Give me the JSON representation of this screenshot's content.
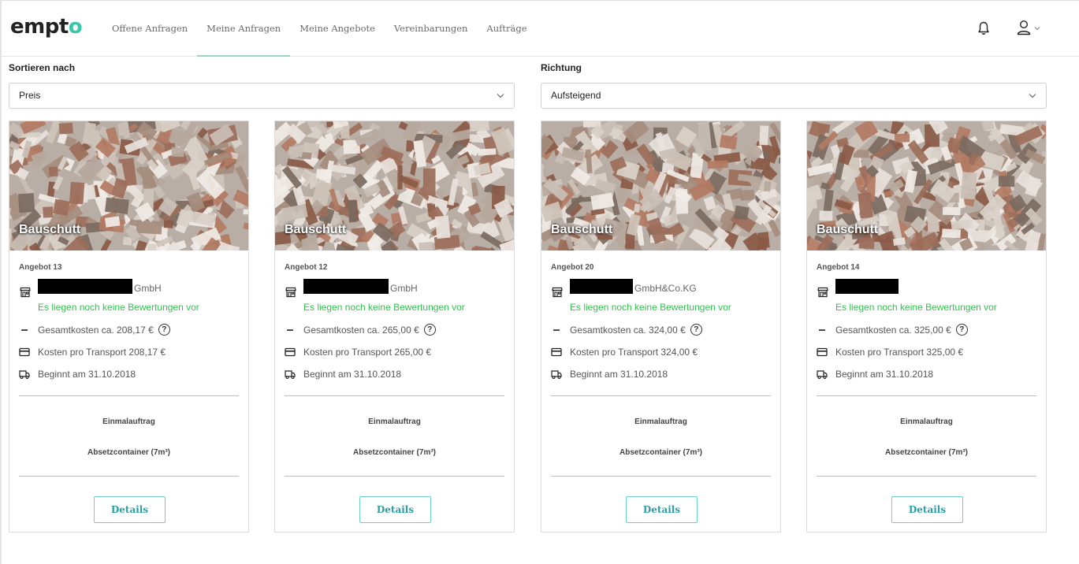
{
  "app": {
    "logo_main": "empt",
    "logo_accent": "o",
    "brand_color": "#3cc6a8"
  },
  "nav": {
    "items": [
      "Offene Anfragen",
      "Meine Anfragen",
      "Meine Angebote",
      "Vereinbarungen",
      "Aufträge"
    ],
    "active_index": 1
  },
  "header_icons": [
    "bell-icon",
    "user-icon",
    "chevron-down-icon"
  ],
  "sort": {
    "label": "Sortieren nach",
    "value": "Preis"
  },
  "direction": {
    "label": "Richtung",
    "value": "Aufsteigend"
  },
  "cards": [
    {
      "category": "Bauschutt",
      "offer": "Angebot 13",
      "company_suffix": "GmbH",
      "ratings": "Es liegen noch keine Bewertungen vor",
      "total": "Gesamtkosten ca. 208,17 €",
      "per_transport": "Kosten pro Transport 208,17 €",
      "start": "Beginnt am 31.10.2018",
      "order_type": "Einmalauftrag",
      "container": "Absetzcontainer (7m³)",
      "details": "Details"
    },
    {
      "category": "Bauschutt",
      "offer": "Angebot 12",
      "company_suffix": "GmbH",
      "ratings": "Es liegen noch keine Bewertungen vor",
      "total": "Gesamtkosten ca. 265,00 €",
      "per_transport": "Kosten pro Transport 265,00 €",
      "start": "Beginnt am 31.10.2018",
      "order_type": "Einmalauftrag",
      "container": "Absetzcontainer (7m³)",
      "details": "Details"
    },
    {
      "category": "Bauschutt",
      "offer": "Angebot 20",
      "company_suffix": "GmbH&Co.KG",
      "ratings": "Es liegen noch keine Bewertungen vor",
      "total": "Gesamtkosten ca. 324,00 €",
      "per_transport": "Kosten pro Transport 324,00 €",
      "start": "Beginnt am 31.10.2018",
      "order_type": "Einmalauftrag",
      "container": "Absetzcontainer (7m³)",
      "details": "Details"
    },
    {
      "category": "Bauschutt",
      "offer": "Angebot 14",
      "company_suffix": "",
      "ratings": "Es liegen noch keine Bewertungen vor",
      "total": "Gesamtkosten ca. 325,00 €",
      "per_transport": "Kosten pro Transport 325,00 €",
      "start": "Beginnt am 31.10.2018",
      "order_type": "Einmalauftrag",
      "container": "Absetzcontainer (7m³)",
      "details": "Details"
    }
  ],
  "help_glyph": "?",
  "colors": {
    "rating_green": "#32c24e",
    "button_border": "#6dd2c6",
    "button_text": "#2a9fa6",
    "nav_active_underline": "#9ad3c5"
  }
}
